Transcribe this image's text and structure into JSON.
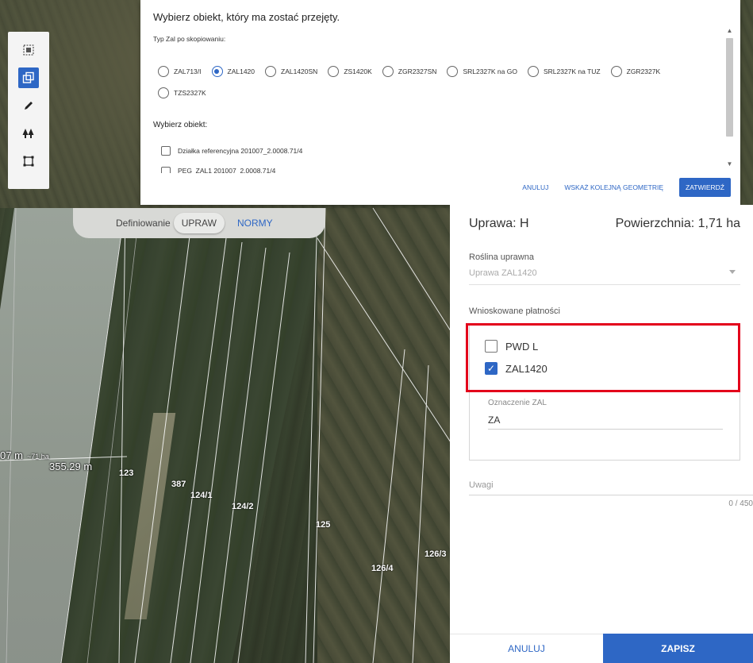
{
  "dialog": {
    "title": "Wybierz obiekt, który ma zostać przejęty.",
    "subtitle": "Typ Zal po skopiowaniu:",
    "radio_options": [
      {
        "label": "ZAL713/I",
        "checked": false
      },
      {
        "label": "ZAL1420",
        "checked": true
      },
      {
        "label": "ZAL1420SN",
        "checked": false
      },
      {
        "label": "ZS1420K",
        "checked": false
      },
      {
        "label": "ZGR2327SN",
        "checked": false
      },
      {
        "label": "SRL2327K na GO",
        "checked": false
      },
      {
        "label": "SRL2327K na TUZ",
        "checked": false
      },
      {
        "label": "ZGR2327K",
        "checked": false
      },
      {
        "label": "TZS2327K",
        "checked": false
      }
    ],
    "objects_title": "Wybierz obiekt:",
    "objects": [
      "Działka referencyjna 201007_2.0008.71/4",
      "PEG_ZAL1 201007_2.0008.71/4"
    ],
    "cancel_label": "ANULUJ",
    "next_geometry_label": "WSKAŻ KOLEJNĄ GEOMETRIĘ",
    "confirm_label": "ZATWIERDŹ"
  },
  "mode_pill": {
    "prefix": "Definiowanie",
    "tab_active": "UPRAW",
    "tab_other": "NORMY"
  },
  "map": {
    "parcel_labels": [
      "123",
      "387",
      "124/1",
      "124/2",
      "125",
      "126/4",
      "126/3"
    ],
    "measure_main": "355.29 m",
    "measure_left": "07 m",
    "measure_small": "~71 ha"
  },
  "panel": {
    "title": "Uprawa: H",
    "area": "Powierzchnia: 1,71 ha",
    "crop_label": "Roślina uprawna",
    "crop_value": "Uprawa ZAL1420",
    "payments_label": "Wnioskowane płatności",
    "payments": [
      {
        "label": "PWD L",
        "checked": false
      },
      {
        "label": "ZAL1420",
        "checked": true
      }
    ],
    "zal_label": "Oznaczenie ZAL",
    "zal_value": "ZA",
    "notes_label": "Uwagi",
    "notes_counter": "0 / 450",
    "cancel_label": "ANULUJ",
    "save_label": "ZAPISZ"
  },
  "colors": {
    "accent": "#2e67c5",
    "highlight": "#e3001b"
  },
  "toolbar": {
    "icons": [
      "select-area-icon",
      "copy-geometry-icon",
      "pencil-icon",
      "trees-icon",
      "rectangle-icon"
    ]
  }
}
